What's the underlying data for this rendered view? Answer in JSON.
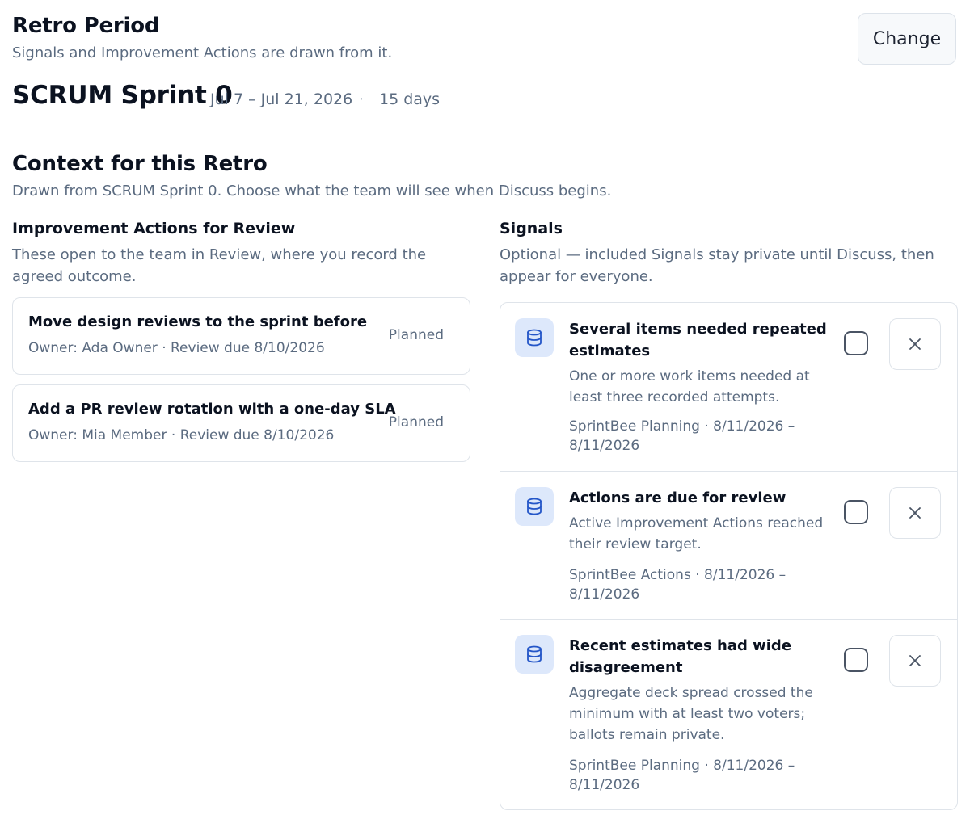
{
  "header": {
    "title": "Retro Period",
    "subtitle": "Signals and Improvement Actions are drawn from it.",
    "change_label": "Change"
  },
  "sprint": {
    "name": "SCRUM Sprint 0",
    "dates": "Jul 7 – Jul 21, 2026",
    "separator": "·",
    "duration": "15 days"
  },
  "context": {
    "title": "Context for this Retro",
    "subtitle": "Drawn from SCRUM Sprint 0. Choose what the team will see when Discuss begins."
  },
  "actions": {
    "title": "Improvement Actions for Review",
    "subtitle": "These open to the team in Review, where you record the agreed outcome.",
    "items": [
      {
        "title": "Move design reviews to the sprint before",
        "meta": "Owner: Ada Owner · Review due 8/10/2026",
        "status": "Planned"
      },
      {
        "title": "Add a PR review rotation with a one-day SLA",
        "meta": "Owner: Mia Member · Review due 8/10/2026",
        "status": "Planned"
      }
    ]
  },
  "signals": {
    "title": "Signals",
    "subtitle": "Optional — included Signals stay private until Discuss, then appear for everyone.",
    "icon": "database-icon",
    "items": [
      {
        "title": "Several items needed repeated estimates",
        "description": "One or more work items needed at least three recorded attempts.",
        "source": "SprintBee Planning · 8/11/2026 – 8/11/2026",
        "checked": false
      },
      {
        "title": "Actions are due for review",
        "description": "Active Improvement Actions reached their review target.",
        "source": "SprintBee Actions · 8/11/2026 – 8/11/2026",
        "checked": false
      },
      {
        "title": "Recent estimates had wide disagreement",
        "description": "Aggregate deck spread crossed the minimum with at least two voters; ballots remain private.",
        "source": "SprintBee Planning · 8/11/2026 – 8/11/2026",
        "checked": false
      }
    ]
  },
  "colors": {
    "text": "#0b1220",
    "muted": "#5b6b80",
    "border": "#dfe4ea",
    "icon_bg": "#dde8fb",
    "icon_stroke": "#2456c8"
  }
}
